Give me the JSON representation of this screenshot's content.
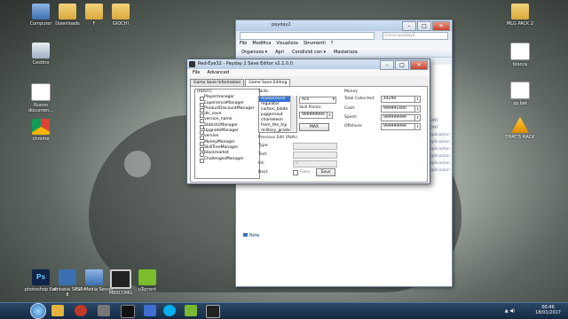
{
  "desktop": {
    "left_icons": [
      {
        "icon": "computer-icon",
        "label": "Computer"
      },
      {
        "icon": "folder-icon",
        "label": "Downloads"
      },
      {
        "icon": "folder-icon",
        "label": "F"
      },
      {
        "icon": "folder-icon",
        "label": "GIOCHI"
      },
      {
        "icon": "recycle-bin-icon",
        "label": "Cestino"
      },
      {
        "icon": "document-icon",
        "label": "Nuovo documen..."
      },
      {
        "icon": "chrome-icon",
        "label": "chrome"
      },
      {
        "icon": "photoshop-icon",
        "label": "photoshop cs6"
      },
      {
        "icon": "camtasia-icon",
        "label": "Camtasia Studio 8"
      },
      {
        "icon": "psp-media-icon",
        "label": "PSP Media Server"
      },
      {
        "icon": "clock-app-icon",
        "label": "M80COMG"
      },
      {
        "icon": "utorrent-icon",
        "label": "uTorrent"
      }
    ],
    "right_icons": [
      {
        "icon": "folder-icon",
        "label": "MLG PACK 2"
      },
      {
        "icon": "document-icon",
        "label": "blocca"
      },
      {
        "icon": "document-icon",
        "label": "zp.bat"
      },
      {
        "icon": "warning-icon",
        "label": "THAT'S HACK"
      }
    ]
  },
  "explorer": {
    "title": "payday2",
    "menu": [
      "File",
      "Modifica",
      "Visualizza",
      "Strumenti",
      "?"
    ],
    "commands": [
      "Organizza ▾",
      "Apri",
      "Condividi con ▾",
      "Masterizza"
    ],
    "search_placeholder": "Cerca payday2",
    "right_column": [
      "...CONF",
      "...CONF",
      "...applicazion",
      "...applicazion",
      "...applicazion",
      "...applicazion",
      "...applicazion",
      "...applicazion"
    ],
    "nav_network": "Rete"
  },
  "editor": {
    "title": "Red-Eye32 - Payday 2 Save Editor v2.1.0.0",
    "menu": [
      "File",
      "Advanced"
    ],
    "tabs": [
      "Game Save Information",
      "Game Save Editing"
    ],
    "tree_root": "[ROOT]",
    "tree_items": [
      "Playermanager",
      "ExperienceManager",
      "ProductDiscountManager",
      "dlc_save",
      "version_name",
      "StatisticManager",
      "UpgradeManager",
      "version",
      "MoneyManager",
      "SkillTreeManager",
      "blackmarket",
      "ChallengesManager"
    ],
    "skills_label": "Skills",
    "skills": [
      "mastermind",
      "regulator",
      "carbon_blade",
      "juggernaut",
      "chameleon",
      "from_the_hip",
      "military_grade"
    ],
    "skill_level": "Ace",
    "skill_points_label": "Skill Points:",
    "skill_points_value": "999999999",
    "max_button": "MAX",
    "money_label": "Money",
    "total_collected_label": "Total Collected:",
    "total_collected_value": "44290",
    "cash_label": "Cash:",
    "cash_value": "999991400",
    "spent_label": "Spent:",
    "spent_value": "999999999",
    "offshore_label": "Offshore:",
    "offshore_value": "999999999",
    "previous_edit_label": "Previous Edit (Path)",
    "type_label": "Type:",
    "text_label": "Text:",
    "int_label": "Int:",
    "int_value": "0",
    "bool_label": "Bool:",
    "false_label": "False",
    "save_button": "Save"
  },
  "taskbar": {
    "time": "00:46",
    "date": "18/01/2017",
    "tray": "▲ ◀)"
  }
}
